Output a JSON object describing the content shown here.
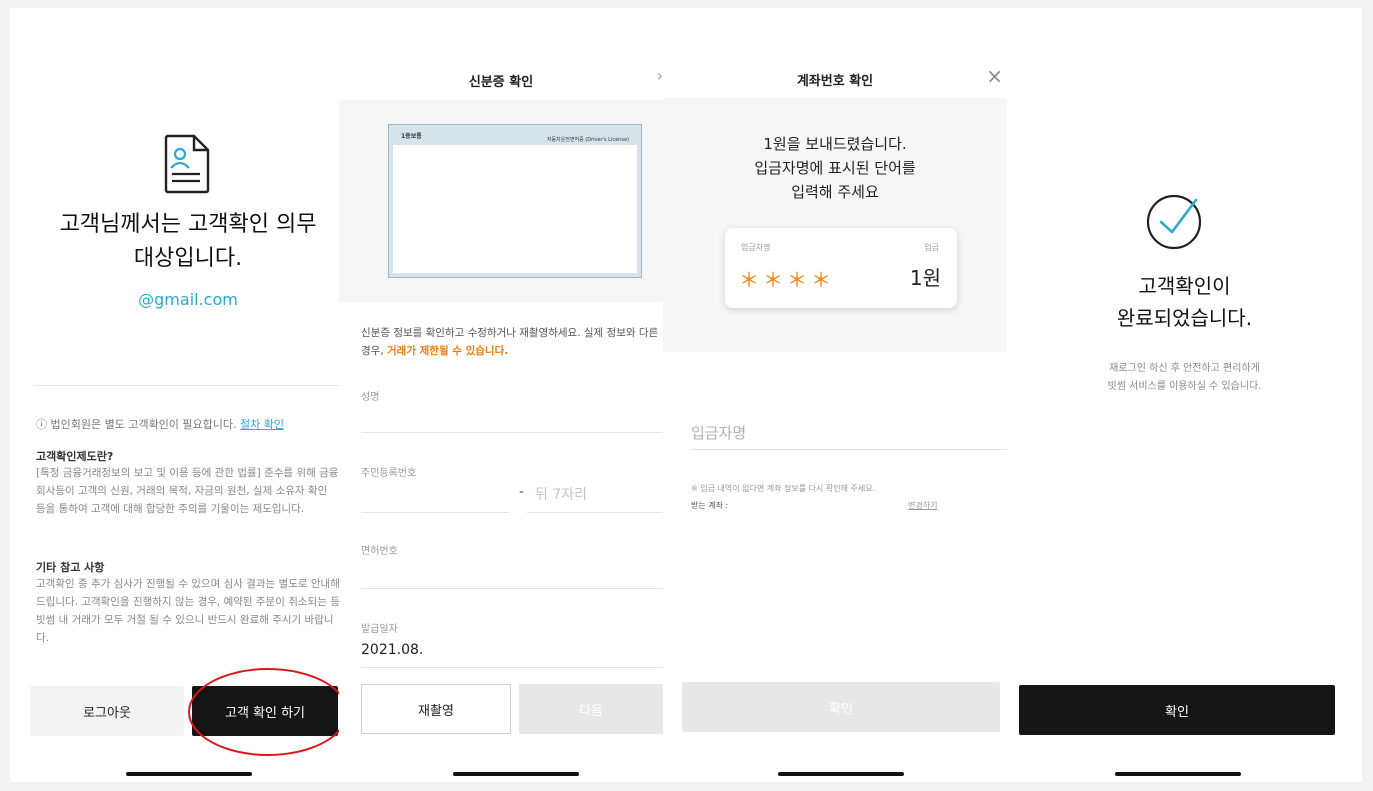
{
  "panel1": {
    "title_line1": "고객님께서는 고객확인 의무",
    "title_line2": "대상입니다.",
    "email": "@gmail.com",
    "notice_text": "ⓘ 법인회원은 별도 고객확인이 필요합니다.",
    "notice_link": "절차 확인",
    "section1_title": "고객확인제도란?",
    "section1_body": "[특정 금융거래정보의 보고 및 이용 등에 관한 법률] 준수를 위해 금융회사등이 고객의 신원, 거래의 목적, 자금의 원천, 실제 소유자 확인 등을 통하여 고객에 대해 합당한 주의를 기울이는 제도입니다.",
    "section2_title": "기타 참고 사항",
    "section2_body": "고객확인 중 추가 심사가 진행될 수 있으며 심사 결과는 별도로 안내해 드립니다. 고객확인을 진행하지 않는 경우, 예약된 주문이 취소되는 등 빗썸 내 거래가 모두 거절 될 수 있으니 반드시 완료해 주시기 바랍니다.",
    "logout_label": "로그아웃",
    "verify_label": "고객 확인 하기"
  },
  "panel2": {
    "header_title": "신분증 확인",
    "header_arrow": "›",
    "card_top_left": "1종보통",
    "card_top_right": "자동차운전면허증 (Driver's License)",
    "info_text": "신분증 정보를 확인하고 수정하거나 재촬영하세요. 실제 정보와 다른 경우, ",
    "info_warning": "거래가 제한될 수 있습니다.",
    "name_label": "성명",
    "rrn_label": "주민등록번호",
    "rrn_dash": "-",
    "rrn_placeholder": "뒤 7자리",
    "license_label": "면허번호",
    "issue_label": "발급일자",
    "issue_value": "2021.08.",
    "retake_label": "재촬영",
    "next_label": "다음"
  },
  "panel3": {
    "header_title": "계좌번호 확인",
    "close_icon": "×",
    "message_line1": "1원을 보내드렸습니다.",
    "message_line2": "입금자명에 표시된 단어를",
    "message_line3": "입력해 주세요",
    "card_left_label": "입금자명",
    "card_right_label": "입금",
    "masked_name": "＊＊＊＊",
    "amount": "1원",
    "depositor_placeholder": "입금자명",
    "note": "※ 입금 내역이 없다면 계좌 정보를 다시 확인해 주세요.",
    "account_label": "받는 계좌 : ",
    "change_link": "변경하기",
    "confirm_label": "확인"
  },
  "panel4": {
    "title_line1": "고객확인이",
    "title_line2": "완료되었습니다.",
    "desc_line1": "재로그인 하신 후 안전하고 편리하게",
    "desc_line2": "빗썸 서비스를 이용하실 수 있습니다.",
    "confirm_label": "확인"
  },
  "colors": {
    "accent_blue": "#2aa9d2",
    "warning_orange": "#ef7d10",
    "highlight_red": "#d9181e",
    "button_dark": "#151515"
  }
}
